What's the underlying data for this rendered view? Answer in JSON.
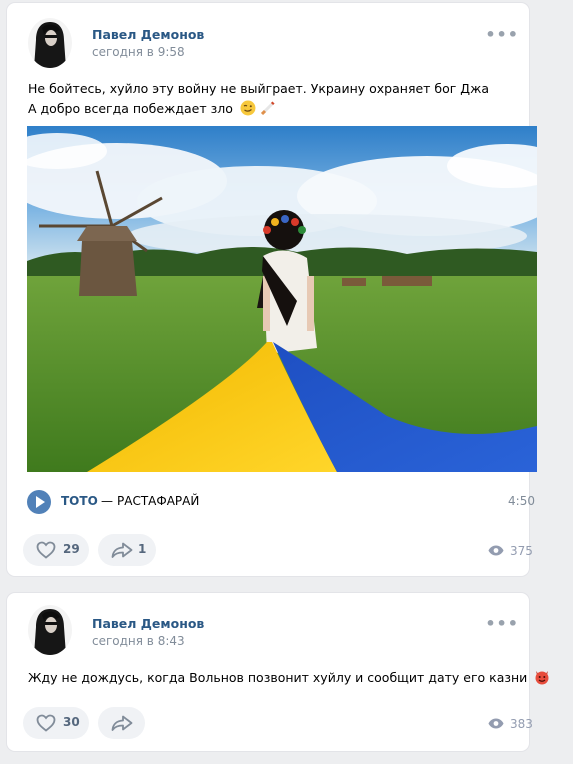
{
  "posts": [
    {
      "author": "Павел Демонов",
      "time": "сегодня в 9:58",
      "text_lines": [
        "Не бойтесь, хуйло эту войну не выйграет. Украину охраняет бог Джа",
        "А добро всегда побеждает зло"
      ],
      "emoji_after_text": [
        "wink-emoji",
        "cigarette-emoji"
      ],
      "audio": {
        "artist": "ТОТО",
        "separator": "—",
        "title": "РАСТАФАРАЙ",
        "duration": "4:50"
      },
      "likes": "29",
      "shares": "1",
      "views": "375"
    },
    {
      "author": "Павел Демонов",
      "time": "сегодня в 8:43",
      "text_lines": [
        "Жду не дождусь, когда Вольнов позвонит хуйлу и сообщит дату его казни"
      ],
      "emoji_after_text": [
        "devil-emoji"
      ],
      "likes": "30",
      "views": "383"
    }
  ],
  "colors": {
    "link": "#2a5885",
    "secondary": "#818c99",
    "page_bg": "#edeef0",
    "flag_blue": "#1f54c9",
    "flag_yellow": "#f5c400"
  }
}
